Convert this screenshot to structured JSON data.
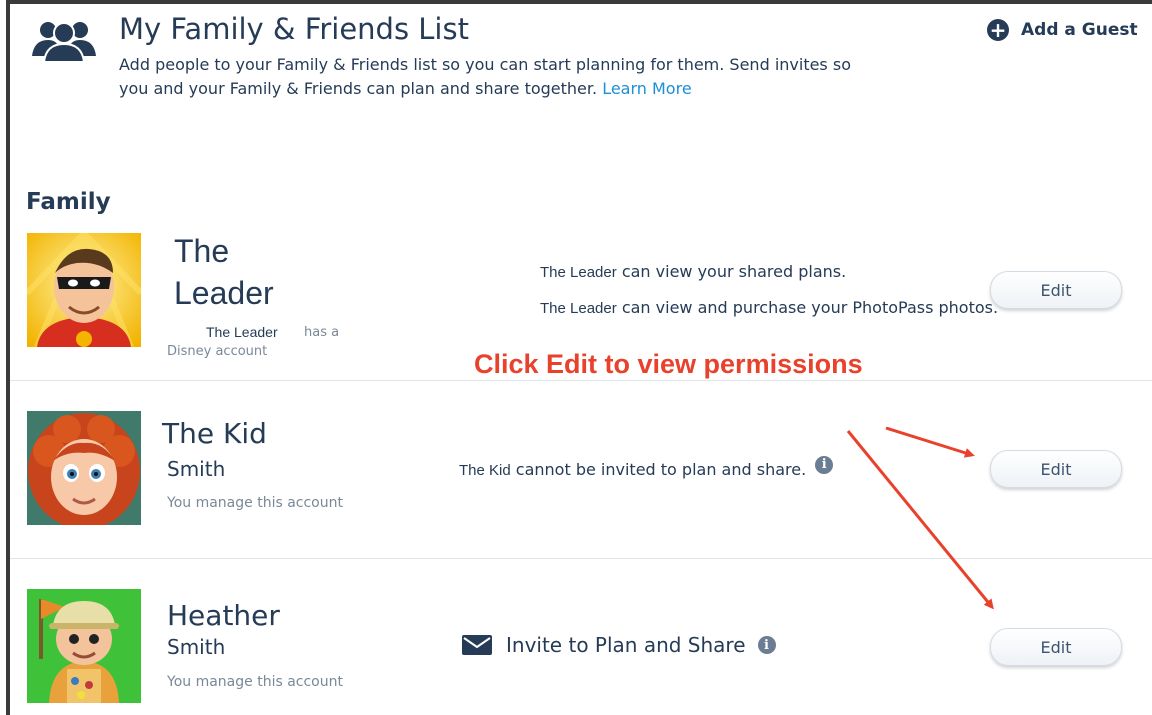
{
  "header": {
    "title": "My Family & Friends List",
    "description": "Add people to your Family & Friends list so you can start planning for them. Send invites so you and your Family & Friends can plan and share together.",
    "learn_more": "Learn More",
    "add_guest": "Add a Guest",
    "icon": "people-group-icon"
  },
  "section": {
    "title": "Family"
  },
  "members": [
    {
      "first": "The",
      "last": "Leader",
      "account_name": "The Leader",
      "account_suffix": "has a",
      "account_line2": "Disney account",
      "perm1_name": "The Leader",
      "perm1_text": "can view your shared plans.",
      "perm2_name": "The Leader",
      "perm2_text": "can view and purchase your PhotoPass photos.",
      "edit": "Edit"
    },
    {
      "first": "The Kid",
      "last": "Smith",
      "sub": "You manage this account",
      "perm_name": "The Kid",
      "perm_text": "cannot be invited to plan and share.",
      "edit": "Edit"
    },
    {
      "first": "Heather",
      "last": "Smith",
      "sub": "You manage this account",
      "invite": "Invite to Plan and Share",
      "edit": "Edit"
    }
  ],
  "annotation": "Click Edit to view permissions",
  "colors": {
    "navy": "#253b56",
    "link": "#1b8fd8",
    "annotation": "#e8412c"
  }
}
